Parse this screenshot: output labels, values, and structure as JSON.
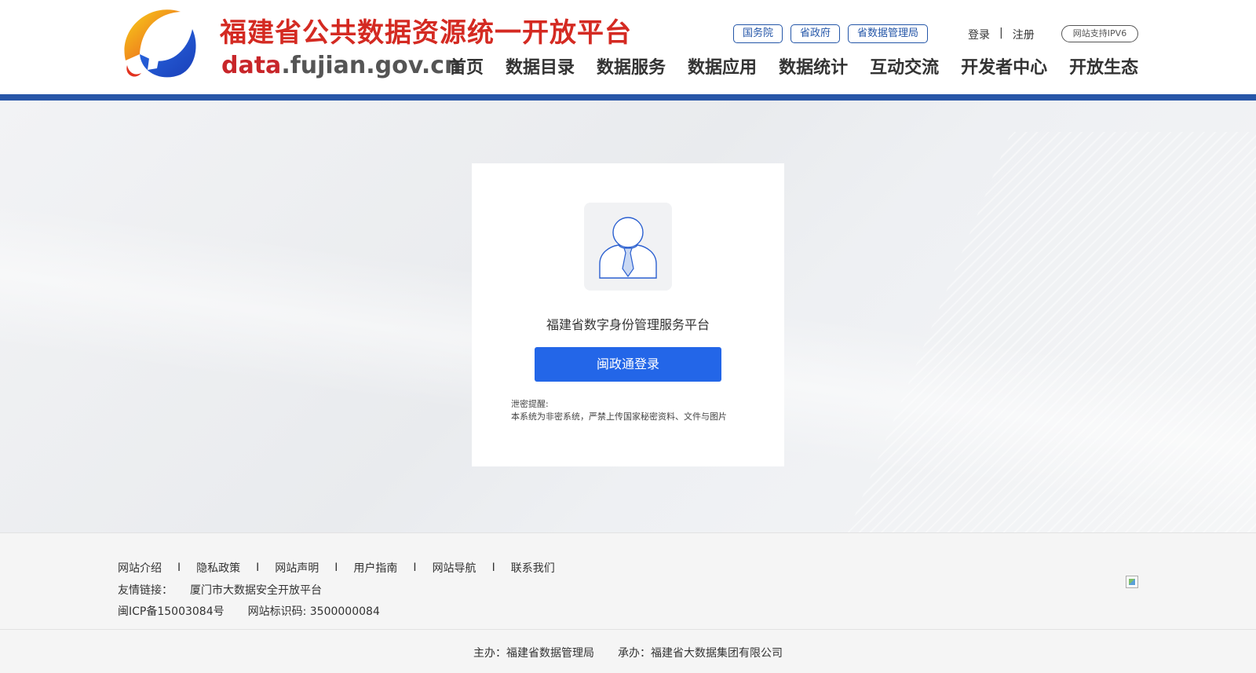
{
  "header": {
    "site_title": "福建省公共数据资源统一开放平台",
    "domain_part1": "data",
    "domain_part2": ".fujian.gov.cn",
    "top_links": [
      "国务院",
      "省政府",
      "省数据管理局"
    ],
    "login": "登录",
    "auth_separator": "|",
    "register": "注册",
    "ipv6_badge": "网站支持IPV6",
    "nav": [
      "首页",
      "数据目录",
      "数据服务",
      "数据应用",
      "数据统计",
      "互动交流",
      "开发者中心",
      "开放生态"
    ]
  },
  "login_card": {
    "title": "福建省数字身份管理服务平台",
    "button_label": "闽政通登录",
    "warning_label": "泄密提醒:",
    "warning_text": "本系统为非密系统，严禁上传国家秘密资料、文件与图片"
  },
  "footer": {
    "links": [
      "网站介绍",
      "隐私政策",
      "网站声明",
      "用户指南",
      "网站导航",
      "联系我们"
    ],
    "separator": "I",
    "friend_links_label": "友情链接：",
    "friend_links": [
      "厦门市大数据安全开放平台"
    ],
    "icp": "闽ICP备15003084号",
    "site_code": "网站标识码: 3500000084",
    "host": "主办：福建省数据管理局",
    "organizer": "承办：福建省大数据集团有限公司"
  },
  "colors": {
    "brand_red": "#d42a22",
    "brand_blue": "#2856a8",
    "button_blue": "#2366e8"
  }
}
